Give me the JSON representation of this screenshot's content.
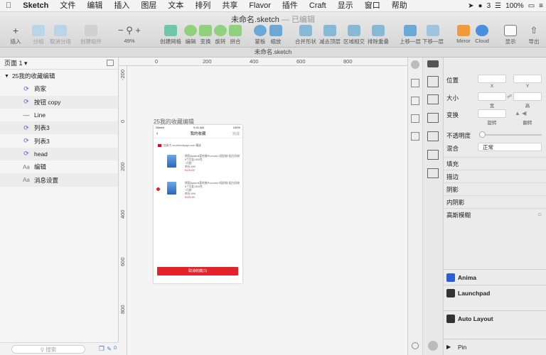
{
  "menubar": {
    "app": "Sketch",
    "items": [
      "文件",
      "编辑",
      "插入",
      "图层",
      "文本",
      "排列",
      "共享",
      "Flavor",
      "插件",
      "Craft",
      "显示",
      "窗口",
      "帮助"
    ],
    "status": {
      "battery": "100%",
      "badge": "3"
    }
  },
  "document": {
    "title": "未命名.sketch",
    "state": "— 已编辑",
    "tab": "未命名.sketch"
  },
  "toolbar": {
    "insert": "插入",
    "group": "分组",
    "ungroup": "取消分组",
    "create_symbol": "创建组件",
    "zoom": "49%",
    "create_grid": "创建网格",
    "edit": "编辑",
    "transform": "变换",
    "rotate": "旋转",
    "flatten": "拼合",
    "mask": "蒙板",
    "scale": "缩放",
    "union": "合并形状",
    "subtract": "减去顶层",
    "intersect": "区域相交",
    "difference": "排除重叠",
    "forward": "上移一层",
    "backward": "下移一层",
    "mirror": "Mirror",
    "cloud": "Cloud",
    "view": "显示",
    "export": "导出"
  },
  "layers": {
    "page": "页面 1",
    "artboard": "25我的收藏编辑",
    "items": [
      {
        "name": "商家",
        "icon": "symbol-icon"
      },
      {
        "name": "按钮 copy",
        "icon": "symbol-icon"
      },
      {
        "name": "Line",
        "icon": "line-icon"
      },
      {
        "name": "列表3",
        "icon": "symbol-icon"
      },
      {
        "name": "列表3",
        "icon": "symbol-icon"
      },
      {
        "name": "head",
        "icon": "symbol-icon"
      },
      {
        "name": "编辑",
        "icon": "text-icon"
      },
      {
        "name": "消息设置",
        "icon": "text-icon"
      }
    ],
    "search_placeholder": "搜索",
    "count": "0"
  },
  "rulers": {
    "top": [
      "0",
      "200",
      "400",
      "600",
      "800"
    ],
    "left": [
      "-200",
      "0",
      "200",
      "400",
      "600",
      "800"
    ]
  },
  "artboard": {
    "title": "25我的收藏编辑",
    "status_left": "Sketch",
    "status_time": "9:41 AM",
    "status_right": "100%",
    "nav_title": "我的收藏",
    "nav_done": "完成",
    "store": "加拿大 ecofriendlyapt.com 精选",
    "item1_title": "德国Aptamil爱他美Pronutra 2段奶粉 配方奶粉6个月起 800克",
    "item1_line2": "7月龄",
    "item1_line3": "库存:999",
    "item1_price": "¥125.00",
    "item2_title": "德国Aptamil爱他美Pronutra 2段奶粉 配方奶粉6个月起 800克",
    "item2_line2": "7月龄",
    "item2_line3": "库存:999",
    "item2_price": "¥125.00",
    "button": "取消收藏(1)"
  },
  "inspector": {
    "position": "位置",
    "x": "X",
    "y": "Y",
    "size": "大小",
    "width": "宽",
    "height": "高",
    "transform": "变换",
    "rotate": "旋转",
    "flip": "翻转",
    "opacity": "不透明度",
    "blending": "混合",
    "blend_value": "正常",
    "fill": "填充",
    "border": "描边",
    "shadow": "阴影",
    "inner_shadow": "内阴影",
    "blur": "高斯模糊",
    "plugins": [
      "Anima",
      "Launchpad",
      "Auto Layout",
      "Pin"
    ]
  }
}
